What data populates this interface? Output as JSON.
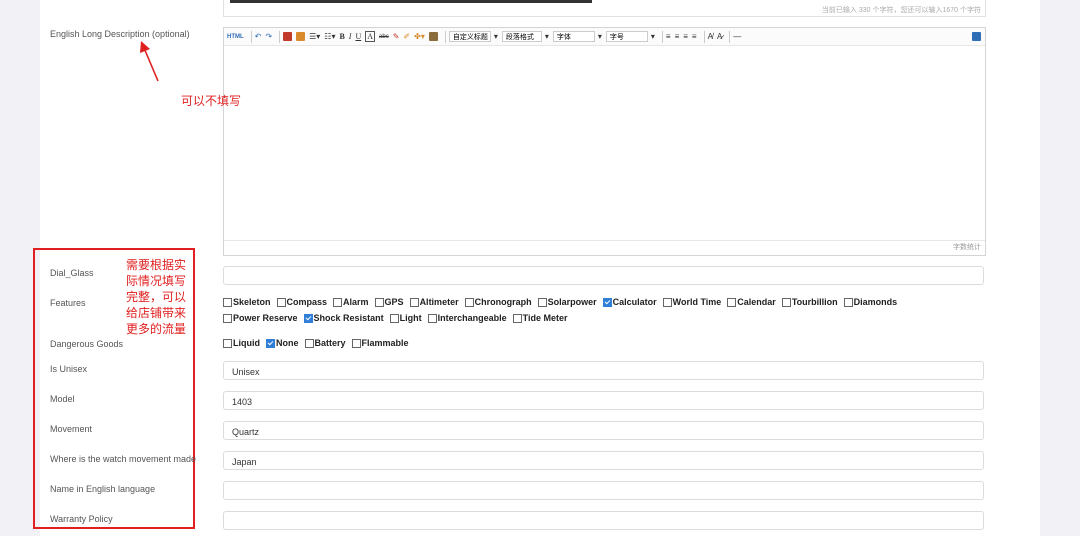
{
  "top_counter": "当前已输入 330 个字符，您还可以输入1670 个字符",
  "long_desc": {
    "label": "English Long Description (optional)",
    "toolbar": {
      "html_label": "HTML",
      "bold": "B",
      "italic": "I",
      "underline": "U",
      "text_color": "A",
      "strike": "abc",
      "select_heading": "自定义标题",
      "select_paragraph": "段落格式",
      "select_font": "字体",
      "select_size": "字号"
    },
    "footer": "字数统计"
  },
  "annotations": {
    "optional_note": "可以不填写",
    "fill_note_lines": [
      "需要根据实",
      "际情况填写",
      "完整，可以",
      "给店铺带来",
      "更多的流量"
    ],
    "accent_color": "#e02020"
  },
  "fields": {
    "dial_glass": {
      "label": "Dial_Glass",
      "value": ""
    },
    "features": {
      "label": "Features",
      "row1": [
        {
          "label": "Skeleton",
          "checked": false
        },
        {
          "label": "Compass",
          "checked": false
        },
        {
          "label": "Alarm",
          "checked": false
        },
        {
          "label": "GPS",
          "checked": false
        },
        {
          "label": "Altimeter",
          "checked": false
        },
        {
          "label": "Chronograph",
          "checked": false
        },
        {
          "label": "Solarpower",
          "checked": false
        },
        {
          "label": "Calculator",
          "checked": true
        },
        {
          "label": "World Time",
          "checked": false
        },
        {
          "label": "Calendar",
          "checked": false
        },
        {
          "label": "Tourbillion",
          "checked": false
        },
        {
          "label": "Diamonds",
          "checked": false
        }
      ],
      "row2": [
        {
          "label": "Power Reserve",
          "checked": false
        },
        {
          "label": "Shock Resistant",
          "checked": true
        },
        {
          "label": "Light",
          "checked": false
        },
        {
          "label": "Interchangeable",
          "checked": false
        },
        {
          "label": "Tide Meter",
          "checked": false
        }
      ]
    },
    "dangerous_goods": {
      "label": "Dangerous Goods",
      "options": [
        {
          "label": "Liquid",
          "checked": false
        },
        {
          "label": "None",
          "checked": true
        },
        {
          "label": "Battery",
          "checked": false
        },
        {
          "label": "Flammable",
          "checked": false
        }
      ]
    },
    "is_unisex": {
      "label": "Is Unisex",
      "value": "Unisex"
    },
    "model": {
      "label": "Model",
      "value": "1403"
    },
    "movement": {
      "label": "Movement",
      "value": "Quartz"
    },
    "movement_origin": {
      "label": "Where is the watch movement made",
      "value": "Japan"
    },
    "english_name": {
      "label": "Name in English language",
      "value": ""
    },
    "warranty": {
      "label": "Warranty Policy",
      "value": ""
    }
  }
}
